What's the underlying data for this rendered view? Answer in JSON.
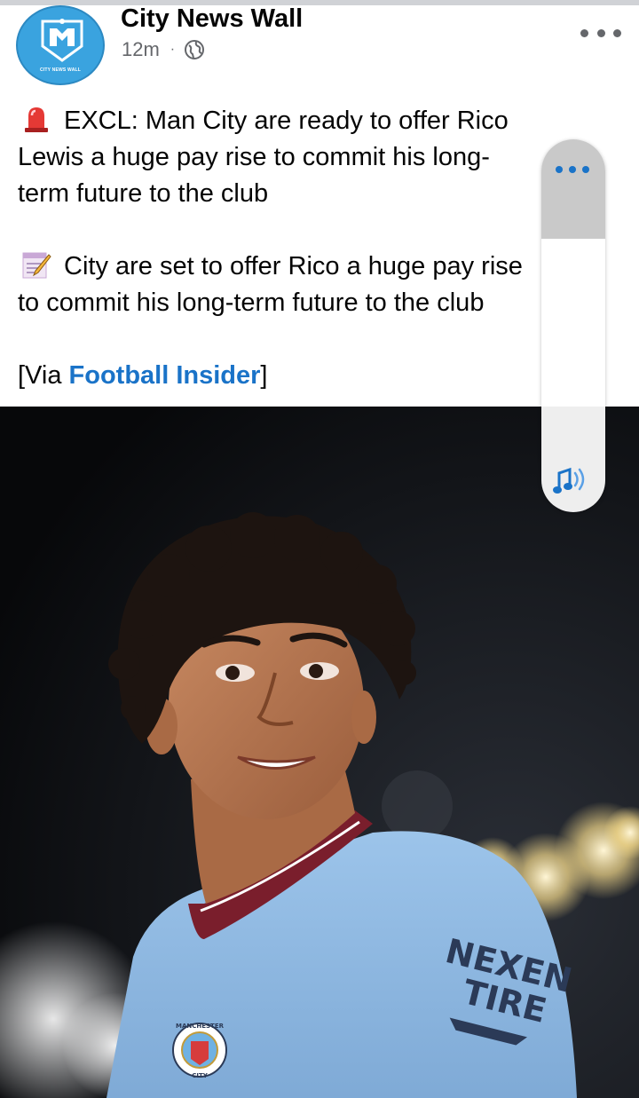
{
  "header": {
    "page_name": "City News Wall",
    "time": "12m",
    "separator": "·",
    "avatar_text": "CITY NEWS WALL"
  },
  "post": {
    "line1": "EXCL: Man City are ready to offer Rico",
    "line2": "Lewis a huge pay rise to commit his long-",
    "line3": "term future to the club",
    "line4": "City are set to offer Rico a huge pay rise",
    "line5": "to commit his long-term future to the club",
    "via_prefix": "[Via ",
    "via_link": "Football Insider",
    "via_suffix": "]"
  },
  "photo": {
    "sponsor_line1": "NEXEN",
    "sponsor_line2": "TIRE",
    "badge_text_top": "MANCHESTER",
    "badge_text_bottom": "CITY"
  },
  "icons": {
    "globe": "globe-icon",
    "more": "more-horizontal-icon",
    "siren": "siren-icon",
    "memo": "memo-icon",
    "sound": "sound-icon"
  },
  "colors": {
    "link": "#1a73c8",
    "kit": "#8fb8e0",
    "collar": "#7a1e2c"
  }
}
